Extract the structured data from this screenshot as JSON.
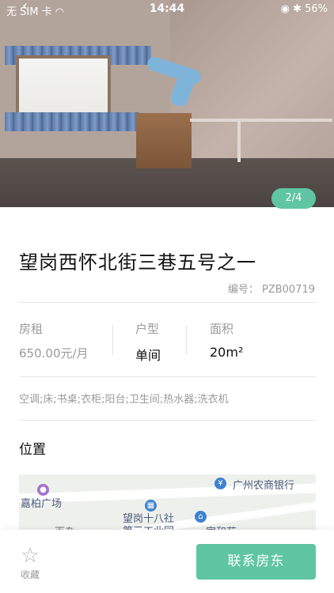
{
  "status_bar": {
    "carrier": "无 SIM 卡",
    "time": "14:44",
    "battery": "56%"
  },
  "gallery": {
    "counter": "2/4"
  },
  "listing": {
    "title": "望岗西怀北街三巷五号之一",
    "code": "编号： PZB00719",
    "rent_label": "房租",
    "rent_value": "650.00元/月",
    "type_label": "户型",
    "type_value": "单间",
    "area_label": "面积",
    "area_value": "20m²",
    "amenities": "空调;床;书桌;衣柜;阳台;卫生间;热水器;洗衣机"
  },
  "location": {
    "section_title": "位置",
    "map_labels": {
      "plaza": "嘉柏广场",
      "bank": "广州农商银行",
      "industrial": "望岗十八社\n第三工业园",
      "garden": "家和苑",
      "partial": "百杂"
    }
  },
  "bottom_bar": {
    "favorite_label": "收藏",
    "contact_label": "联系房东"
  },
  "colors": {
    "accent": "#5fc5a2"
  }
}
